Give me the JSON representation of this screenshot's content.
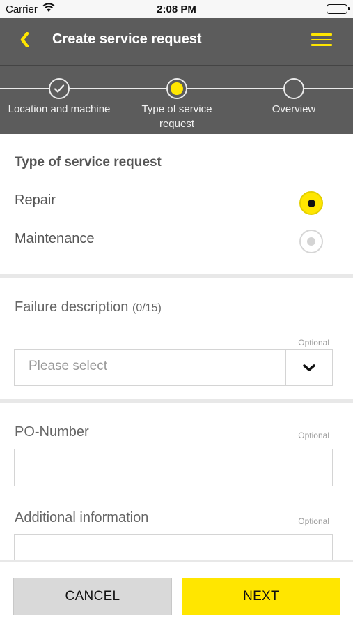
{
  "status_bar": {
    "carrier": "Carrier",
    "time": "2:08 PM"
  },
  "nav": {
    "title": "Create service request",
    "back_icon": "chevron-left-icon",
    "menu_icon": "hamburger-menu-icon",
    "accent": "#ffe600",
    "background": "#5c5c5c"
  },
  "stepper": {
    "steps": [
      {
        "label": "Location and machine",
        "state": "completed"
      },
      {
        "label": "Type of service request",
        "state": "current"
      },
      {
        "label": "Overview",
        "state": "pending"
      }
    ]
  },
  "service_type": {
    "heading": "Type of service request",
    "options": [
      {
        "label": "Repair",
        "selected": true
      },
      {
        "label": "Maintenance",
        "selected": false
      }
    ]
  },
  "failure": {
    "label": "Failure description",
    "counter": "(0/15)",
    "optional": "Optional",
    "placeholder": "Please select"
  },
  "po_number": {
    "label": "PO-Number",
    "optional": "Optional",
    "value": ""
  },
  "additional_info": {
    "label": "Additional information",
    "optional": "Optional",
    "value": ""
  },
  "actions": {
    "cancel": "CANCEL",
    "next": "NEXT"
  }
}
